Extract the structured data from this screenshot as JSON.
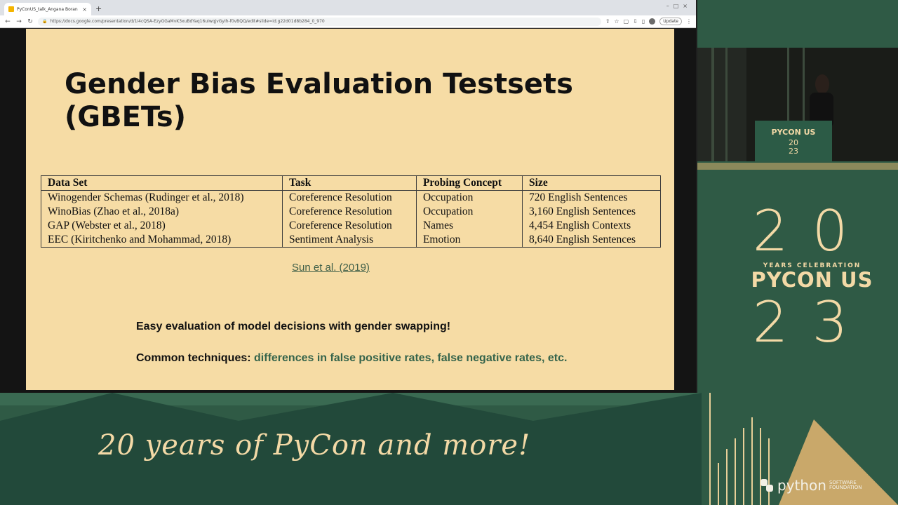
{
  "browser": {
    "tab_title": "PyConUS_talk_Angana Boran",
    "new_tab": "+",
    "url": "https://docs.google.com/presentation/d/1i4cQSA-EzyGGaMvK3xuBdYaq16uIwqjvGyIh-f0vBQQ/edit#slide=id.g22d01d8b284_0_970",
    "update_label": "Update"
  },
  "slide": {
    "title_line1": "Gender Bias Evaluation Testsets",
    "title_line2": "(GBETs)",
    "table": {
      "headers": [
        "Data Set",
        "Task",
        "Probing Concept",
        "Size"
      ],
      "rows": [
        [
          "Winogender Schemas (Rudinger et al., 2018)",
          "Coreference Resolution",
          "Occupation",
          "720 English Sentences"
        ],
        [
          "WinoBias (Zhao et al., 2018a)",
          "Coreference Resolution",
          "Occupation",
          "3,160 English Sentences"
        ],
        [
          "GAP (Webster et al., 2018)",
          "Coreference Resolution",
          "Names",
          "4,454 English Contexts"
        ],
        [
          "EEC (Kiritchenko and Mohammad, 2018)",
          "Sentiment Analysis",
          "Emotion",
          "8,640 English Sentences"
        ]
      ]
    },
    "citation": "Sun et al. (2019)",
    "point1": "Easy evaluation of model decisions with gender swapping!",
    "point2_label": "Common techniques:",
    "point2_value": "differences in false positive rates, false negative rates, etc."
  },
  "event": {
    "podium_name": "PYCON US",
    "podium_year_top": "20",
    "podium_year_bottom": "23",
    "logo_num_top": "20",
    "logo_celebration": "YEARS CELEBRATION",
    "logo_name": "PYCON US",
    "logo_num_bottom": "23",
    "tagline": "20 years of PyCon and more!",
    "sponsor_name": "python",
    "sponsor_sub1": "SOFTWARE",
    "sponsor_sub2": "FOUNDATION"
  },
  "colors": {
    "background": "#2f5a45",
    "slide": "#f6dca5",
    "accent_cream": "#f3d9a6",
    "accent_green_text": "#35644b"
  }
}
